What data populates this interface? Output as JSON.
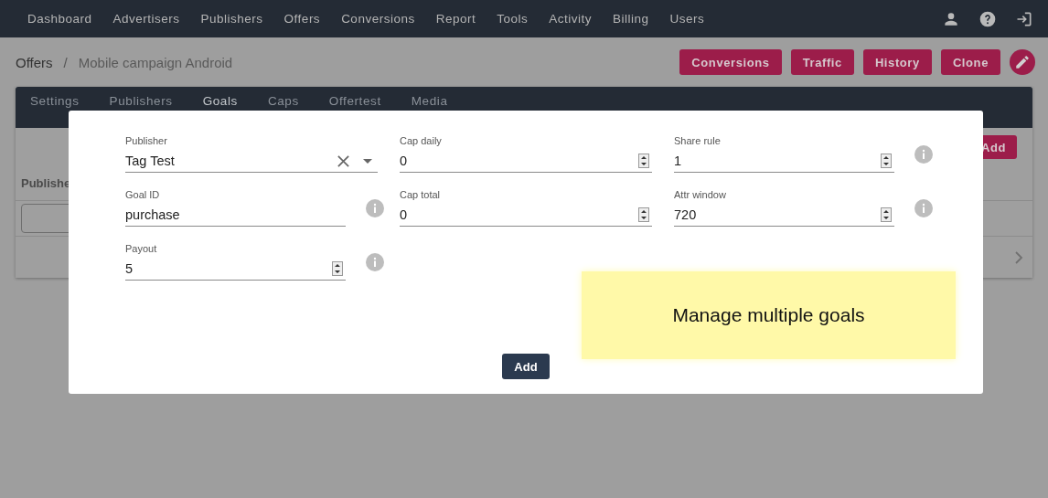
{
  "nav": {
    "items": [
      {
        "label": "Dashboard"
      },
      {
        "label": "Advertisers"
      },
      {
        "label": "Publishers"
      },
      {
        "label": "Offers"
      },
      {
        "label": "Conversions"
      },
      {
        "label": "Report"
      },
      {
        "label": "Tools"
      },
      {
        "label": "Activity"
      },
      {
        "label": "Billing"
      },
      {
        "label": "Users"
      }
    ]
  },
  "breadcrumb": {
    "parent": "Offers",
    "separator": "/",
    "current": "Mobile campaign Android"
  },
  "actions": [
    {
      "label": "Conversions"
    },
    {
      "label": "Traffic"
    },
    {
      "label": "History"
    },
    {
      "label": "Clone"
    }
  ],
  "tabs": [
    {
      "label": "Settings",
      "selected": false
    },
    {
      "label": "Publishers",
      "selected": false
    },
    {
      "label": "Goals",
      "selected": true
    },
    {
      "label": "Caps",
      "selected": false
    },
    {
      "label": "Offertest",
      "selected": false
    },
    {
      "label": "Media",
      "selected": false
    }
  ],
  "card": {
    "column_1": "Publishe",
    "add_button": "Add"
  },
  "modal": {
    "fields": [
      {
        "label": "Publisher",
        "value": "Tag Test",
        "kind": "select",
        "info": false
      },
      {
        "label": "Cap daily",
        "value": "0",
        "kind": "number",
        "info": false
      },
      {
        "label": "Share rule",
        "value": "1",
        "kind": "number",
        "info": true
      },
      {
        "label": "Goal ID",
        "value": "purchase",
        "kind": "text",
        "info": true
      },
      {
        "label": "Cap total",
        "value": "0",
        "kind": "number",
        "info": false
      },
      {
        "label": "Attr window",
        "value": "720",
        "kind": "number",
        "info": true
      },
      {
        "label": "Payout",
        "value": "5",
        "kind": "number",
        "info": true
      }
    ],
    "button": "Add"
  },
  "note": "Manage multiple goals"
}
